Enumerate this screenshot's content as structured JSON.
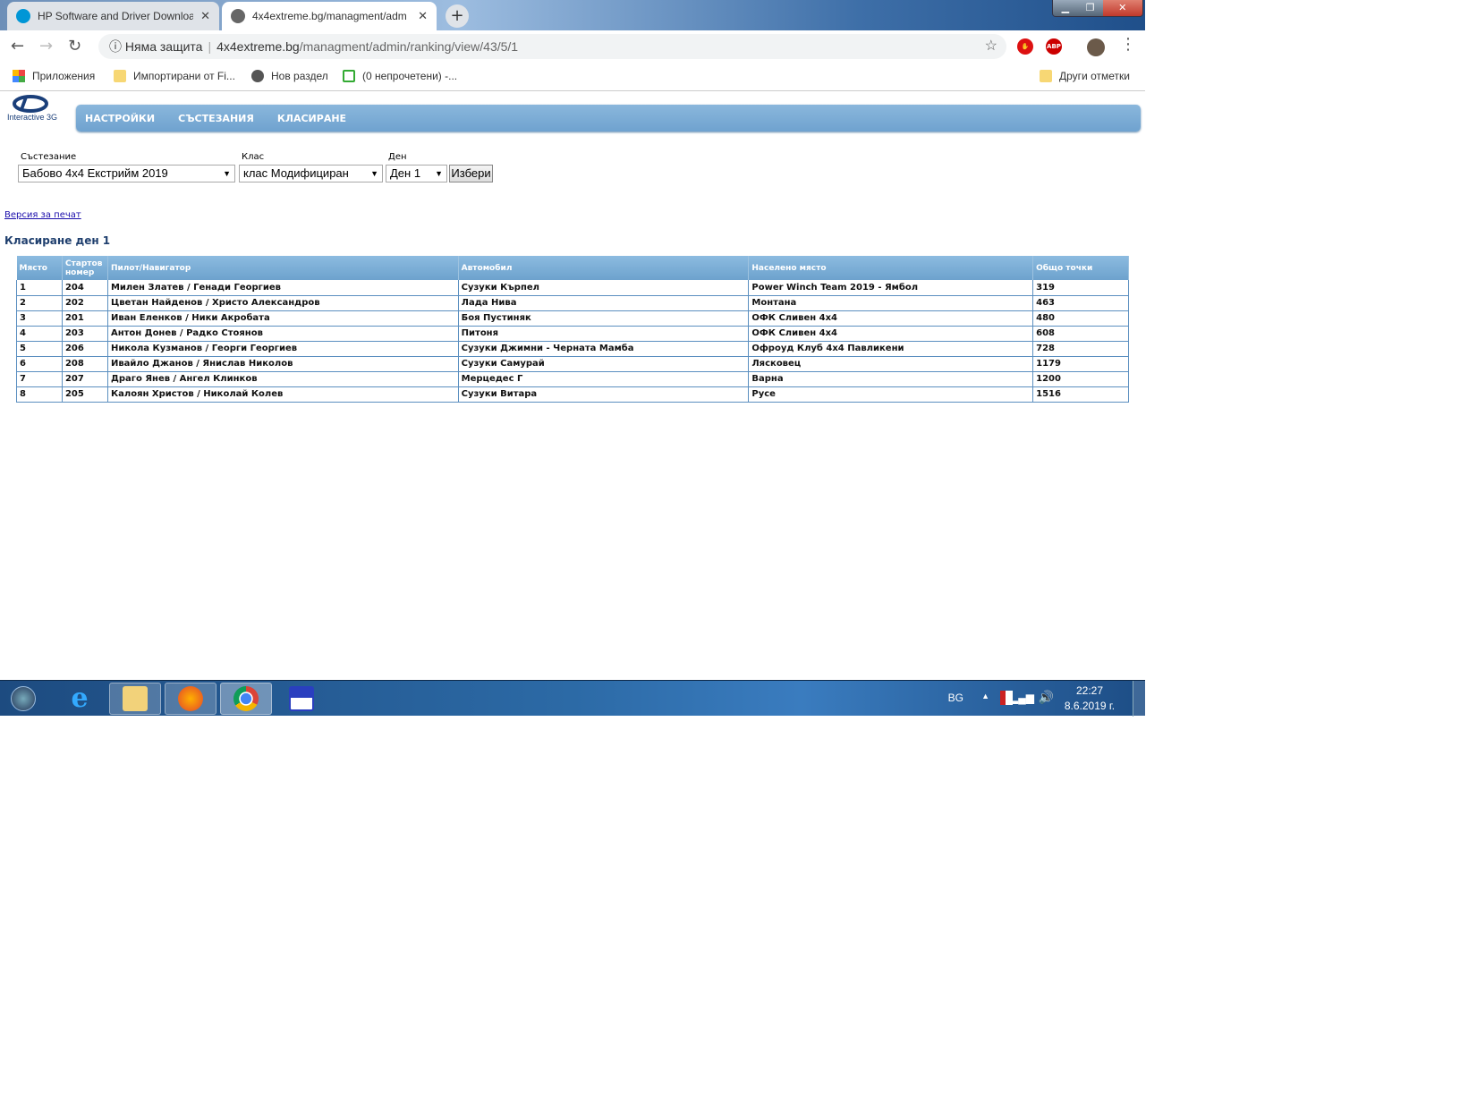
{
  "browser": {
    "tabs": [
      {
        "label": "HP Software and Driver Downloa",
        "icon": "hp-icon",
        "active": false
      },
      {
        "label": "4x4extreme.bg/managment/adm",
        "icon": "globe-icon",
        "active": true
      }
    ],
    "new_tab": "+",
    "security": "Няма защита",
    "url_host": "4x4extreme.bg",
    "url_path": "/managment/admin/ranking/view/43/5/1",
    "bookmarks": [
      {
        "label": "Приложения",
        "icon": "apps-grid-icon"
      },
      {
        "label": "Импортирани от Fi...",
        "icon": "folder-icon"
      },
      {
        "label": "Нов раздел",
        "icon": "globe-icon"
      },
      {
        "label": "(0 непрочетени) -...",
        "icon": "home-icon"
      }
    ],
    "other_bookmarks": "Други отметки",
    "extensions": [
      "ABP"
    ]
  },
  "site": {
    "logo_text": "Interactive 3G",
    "nav": [
      "НАСТРОЙКИ",
      "СЪСТЕЗАНИЯ",
      "КЛАСИРАНЕ"
    ],
    "filters": {
      "competition_label": "Състезание",
      "competition": "Бабово 4х4 Екстрийм 2019",
      "class_label": "Клас",
      "class": "клас Модифициран",
      "day_label": "Ден",
      "day": "Ден 1",
      "submit": "Избери"
    },
    "print_link": "Версия за печат",
    "ranking_title": "Класиране ден 1",
    "table": {
      "headers": [
        "Място",
        "Стартов номер",
        "Пилот/Навигатор",
        "Автомобил",
        "Населено място",
        "Общо точки"
      ],
      "rows": [
        [
          "1",
          "204",
          "Милен Златев / Генади Георгиев",
          "Сузуки Кърпел",
          "Power Winch Team 2019 - Ямбол",
          "319"
        ],
        [
          "2",
          "202",
          "Цветан Найденов / Христо Александров",
          "Лада Нива",
          "Монтана",
          "463"
        ],
        [
          "3",
          "201",
          "Иван Еленков / Ники Акробата",
          "Боя Пустиняк",
          "ОФК Сливен 4x4",
          "480"
        ],
        [
          "4",
          "203",
          "Антон Донев / Радко Стоянов",
          "Питоня",
          "ОФК Сливен 4x4",
          "608"
        ],
        [
          "5",
          "206",
          "Никола Кузманов / Георги Георгиев",
          "Сузуки Джимни - Черната Мамба",
          "Офроуд Клуб 4х4 Павликени",
          "728"
        ],
        [
          "6",
          "208",
          "Ивайло Джанов / Янислав Николов",
          "Сузуки Самурай",
          "Лясковец",
          "1179"
        ],
        [
          "7",
          "207",
          "Драго Янев / Ангел Клинков",
          "Мерцедес Г",
          "Варна",
          "1200"
        ],
        [
          "8",
          "205",
          "Калоян Христов / Николай Колев",
          "Сузуки Витара",
          "Русе",
          "1516"
        ]
      ]
    }
  },
  "taskbar": {
    "lang": "BG",
    "time": "22:27",
    "date": "8.6.2019 г."
  }
}
